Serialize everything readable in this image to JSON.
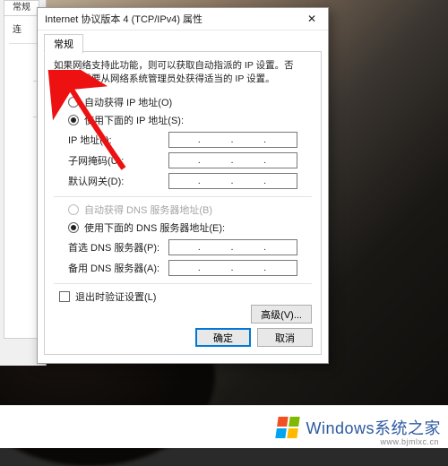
{
  "dialog": {
    "title": "Internet 协议版本 4 (TCP/IPv4) 属性",
    "close_glyph": "✕",
    "tab": "常规",
    "description": "如果网络支持此功能，则可以获取自动指派的 IP 设置。否则，你需要从网络系统管理员处获得适当的 IP 设置。",
    "ip_section": {
      "auto_label": "自动获得 IP 地址(O)",
      "manual_label": "使用下面的 IP 地址(S):",
      "selected": "manual",
      "fields": {
        "ip": "IP 地址(I):",
        "mask": "子网掩码(U):",
        "gateway": "默认网关(D):"
      }
    },
    "dns_section": {
      "auto_label": "自动获得 DNS 服务器地址(B)",
      "manual_label": "使用下面的 DNS 服务器地址(E):",
      "selected": "manual",
      "auto_disabled": true,
      "fields": {
        "preferred": "首选 DNS 服务器(P):",
        "alternate": "备用 DNS 服务器(A):"
      }
    },
    "validate_on_exit": "退出时验证设置(L)",
    "advanced_button": "高级(V)...",
    "ok_button": "确定",
    "cancel_button": "取消"
  },
  "behind": {
    "tab_stub": "常规"
  },
  "watermark": {
    "brand": "Windows",
    "suffix": "系统之家",
    "url": "www.bjmlxc.cn"
  },
  "annotation": {
    "arrow_color": "#e11"
  }
}
